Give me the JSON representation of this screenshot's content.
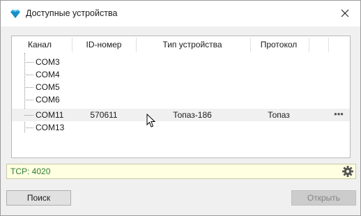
{
  "window": {
    "title": "Доступные устройства",
    "icon": "diamond-icon",
    "close_icon": "close-icon"
  },
  "table": {
    "columns": [
      "Канал",
      "ID-номер",
      "Тип устройства",
      "Протокол"
    ],
    "rows": [
      {
        "channel": "COM3",
        "id": "",
        "type": "",
        "protocol": "",
        "selected": false
      },
      {
        "channel": "COM4",
        "id": "",
        "type": "",
        "protocol": "",
        "selected": false
      },
      {
        "channel": "COM5",
        "id": "",
        "type": "",
        "protocol": "",
        "selected": false
      },
      {
        "channel": "COM6",
        "id": "",
        "type": "",
        "protocol": "",
        "selected": false
      },
      {
        "channel": "COM11",
        "id": "570611",
        "type": "Топаз-186",
        "protocol": "Топаз",
        "selected": true,
        "more": "•••"
      },
      {
        "channel": "COM13",
        "id": "",
        "type": "",
        "protocol": "",
        "selected": false
      }
    ]
  },
  "status": {
    "text": "TCP: 4020",
    "settings_icon": "gear-icon"
  },
  "buttons": {
    "search": "Поиск",
    "open": "Открыть"
  },
  "colors": {
    "status_bg": "#ffffe1",
    "status_text": "#2e7d32",
    "icon_accent": "#29a9e0",
    "selected_row": "#f0f0f0"
  }
}
